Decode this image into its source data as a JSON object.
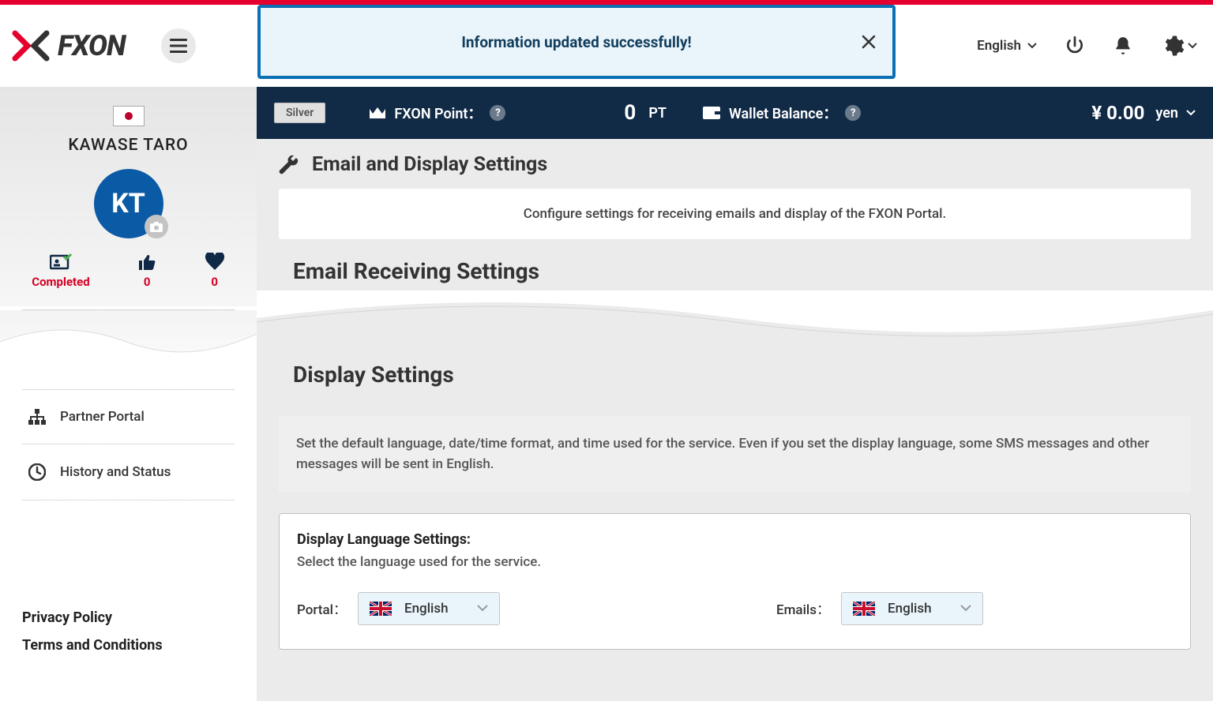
{
  "toast": {
    "message": "Information updated successfully!"
  },
  "header": {
    "lang": "English",
    "logo_text": "FXON"
  },
  "infobar": {
    "tier": "Silver",
    "point_label": "FXON Point：",
    "point_value": "0",
    "point_unit": "PT",
    "wallet_label": "Wallet Balance：",
    "wallet_amount": "¥ 0.00",
    "wallet_currency": "yen"
  },
  "sidebar": {
    "user_name": "KAWASE TARO",
    "avatar_initials": "KT",
    "stats": {
      "completed_label": "Completed",
      "likes": "0",
      "hearts": "0"
    },
    "nav": {
      "partner": "Partner Portal",
      "history": "History and Status"
    },
    "legal": {
      "privacy": "Privacy Policy",
      "terms": "Terms and Conditions"
    }
  },
  "main": {
    "title": "Email and Display Settings",
    "intro": "Configure settings for receiving emails and display of the FXON Portal.",
    "section1": "Email Receiving Settings",
    "section2": "Display Settings",
    "display_desc": "Set the default language, date/time format, and time used for the service. Even if you set the display language, some SMS messages and other messages will be sent in English.",
    "lang_title": "Display Language Settings:",
    "lang_subtitle": "Select the language used for the service.",
    "portal_label": "Portal：",
    "portal_value": "English",
    "emails_label": "Emails：",
    "emails_value": "English"
  }
}
